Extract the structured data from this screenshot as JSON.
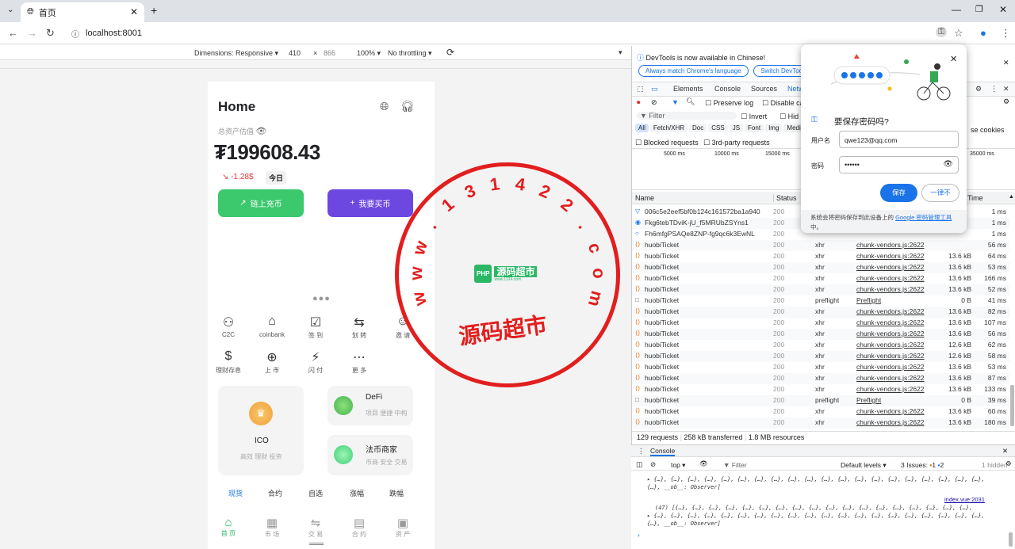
{
  "browser": {
    "tab_title": "首页",
    "url": "localhost:8001"
  },
  "device_toolbar": {
    "dimensions": "Dimensions: Responsive ▾",
    "width": "410",
    "height": "866",
    "zoom": "100% ▾",
    "throttle": "No throttling ▾"
  },
  "app": {
    "title": "Home",
    "balance_label": "总资产估值",
    "balance": "199608.43",
    "change": "-1.28$",
    "today": "今日",
    "btn_deposit": "链上充币",
    "btn_buy": "我要买币",
    "icons": [
      {
        "g": "⚇",
        "t": "C2C"
      },
      {
        "g": "⌂",
        "t": "coinbank"
      },
      {
        "g": "☑",
        "t": "签 到"
      },
      {
        "g": "⇆",
        "t": "划 转"
      },
      {
        "g": "☺",
        "t": "邀 请"
      },
      {
        "g": "$",
        "t": "理财存息"
      },
      {
        "g": "⊕",
        "t": "上 市"
      },
      {
        "g": "⚡",
        "t": "闪 付"
      },
      {
        "g": "⋯",
        "t": "更 多"
      }
    ],
    "ico_title": "ICO",
    "ico_sub": "高效 理财 投资",
    "defi_title": "DeFi",
    "defi_sub": "项目 便捷 中构",
    "fiat_title": "法币商家",
    "fiat_sub": "币商 安全 交易",
    "subtabs": [
      "现货",
      "合约",
      "自选",
      "涨幅",
      "跌幅"
    ],
    "bottom_nav": [
      {
        "g": "⌂",
        "t": "首 页"
      },
      {
        "g": "▦",
        "t": "市 场"
      },
      {
        "g": "⇋",
        "t": "交 易"
      },
      {
        "g": "▤",
        "t": "合 约"
      },
      {
        "g": "▣",
        "t": "资 产"
      }
    ]
  },
  "devtools": {
    "banner": "DevTools is now available in Chinese!",
    "btn_match": "Always match Chrome's language",
    "btn_switch": "Switch DevTool",
    "tabs": [
      "Elements",
      "Console",
      "Sources",
      "Netw"
    ],
    "preserve_log": "Preserve log",
    "disable_cache": "Disable ca",
    "filter": "Filter",
    "invert": "Invert",
    "hide": "Hid",
    "filters": [
      "All",
      "Fetch/XHR",
      "Doc",
      "CSS",
      "JS",
      "Font",
      "Img",
      "Medi"
    ],
    "third_party_cookies": "se cookies",
    "blocked": "Blocked requests",
    "third_party": "3rd-party requests",
    "timeline": [
      "5000 ms",
      "10000 ms",
      "15000 ms",
      "35000 ms"
    ],
    "cols": {
      "name": "Name",
      "status": "Status",
      "time": "Time"
    },
    "rows": [
      {
        "n": "006c5e2eef5bf0b124c161572ba1a940",
        "s": "200",
        "ty": "",
        "in": "",
        "sz": "",
        "tm": "1 ms",
        "ic": "▽"
      },
      {
        "n": "Fkg6tebTDviK-jU_f5MRUbZSYns1",
        "s": "200",
        "ty": "",
        "in": "",
        "sz": "",
        "tm": "1 ms",
        "ic": "◉"
      },
      {
        "n": "Fh6mfgPSAQe8ZNP-fg9qc6k3EwNL",
        "s": "200",
        "ty": "",
        "in": "",
        "sz": "",
        "tm": "1 ms",
        "ic": "○"
      },
      {
        "n": "huobiTicket",
        "s": "200",
        "ty": "xhr",
        "in": "chunk-vendors.js:2622",
        "sz": "",
        "tm": "56 ms",
        "ic": "⟨⟩"
      },
      {
        "n": "huobiTicket",
        "s": "200",
        "ty": "xhr",
        "in": "chunk-vendors.js:2622",
        "sz": "13.6 kB",
        "tm": "64 ms",
        "ic": "⟨⟩"
      },
      {
        "n": "huobiTicket",
        "s": "200",
        "ty": "xhr",
        "in": "chunk-vendors.js:2622",
        "sz": "13.6 kB",
        "tm": "53 ms",
        "ic": "⟨⟩"
      },
      {
        "n": "huobiTicket",
        "s": "200",
        "ty": "xhr",
        "in": "chunk-vendors.js:2622",
        "sz": "13.6 kB",
        "tm": "166 ms",
        "ic": "⟨⟩"
      },
      {
        "n": "huobiTicket",
        "s": "200",
        "ty": "xhr",
        "in": "chunk-vendors.js:2622",
        "sz": "13.6 kB",
        "tm": "52 ms",
        "ic": "⟨⟩"
      },
      {
        "n": "huobiTicket",
        "s": "200",
        "ty": "preflight",
        "in": "Preflight",
        "sz": "0 B",
        "tm": "41 ms",
        "ic": "□"
      },
      {
        "n": "huobiTicket",
        "s": "200",
        "ty": "xhr",
        "in": "chunk-vendors.js:2622",
        "sz": "13.6 kB",
        "tm": "82 ms",
        "ic": "⟨⟩"
      },
      {
        "n": "huobiTicket",
        "s": "200",
        "ty": "xhr",
        "in": "chunk-vendors.js:2622",
        "sz": "13.6 kB",
        "tm": "107 ms",
        "ic": "⟨⟩"
      },
      {
        "n": "huobiTicket",
        "s": "200",
        "ty": "xhr",
        "in": "chunk-vendors.js:2622",
        "sz": "13.6 kB",
        "tm": "56 ms",
        "ic": "⟨⟩"
      },
      {
        "n": "huobiTicket",
        "s": "200",
        "ty": "xhr",
        "in": "chunk-vendors.js:2622",
        "sz": "12.6 kB",
        "tm": "62 ms",
        "ic": "⟨⟩"
      },
      {
        "n": "huobiTicket",
        "s": "200",
        "ty": "xhr",
        "in": "chunk-vendors.js:2622",
        "sz": "12.6 kB",
        "tm": "58 ms",
        "ic": "⟨⟩"
      },
      {
        "n": "huobiTicket",
        "s": "200",
        "ty": "xhr",
        "in": "chunk-vendors.js:2622",
        "sz": "13.6 kB",
        "tm": "53 ms",
        "ic": "⟨⟩"
      },
      {
        "n": "huobiTicket",
        "s": "200",
        "ty": "xhr",
        "in": "chunk-vendors.js:2622",
        "sz": "13.6 kB",
        "tm": "87 ms",
        "ic": "⟨⟩"
      },
      {
        "n": "huobiTicket",
        "s": "200",
        "ty": "xhr",
        "in": "chunk-vendors.js:2622",
        "sz": "13.6 kB",
        "tm": "133 ms",
        "ic": "⟨⟩"
      },
      {
        "n": "huobiTicket",
        "s": "200",
        "ty": "preflight",
        "in": "Preflight",
        "sz": "0 B",
        "tm": "39 ms",
        "ic": "□"
      },
      {
        "n": "huobiTicket",
        "s": "200",
        "ty": "xhr",
        "in": "chunk-vendors.js:2622",
        "sz": "13.6 kB",
        "tm": "60 ms",
        "ic": "⟨⟩"
      },
      {
        "n": "huobiTicket",
        "s": "200",
        "ty": "xhr",
        "in": "chunk-vendors.js:2622",
        "sz": "13.6 kB",
        "tm": "180 ms",
        "ic": "⟨⟩"
      }
    ],
    "summary": {
      "requests": "129 requests",
      "transferred": "258 kB transferred",
      "resources": "1.8 MB resources"
    },
    "console_tab": "Console",
    "console_top": "top ▾",
    "console_filter": "Filter",
    "console_levels": "Default levels ▾",
    "console_issues": "3 Issues:",
    "console_issue_warn": "1",
    "console_issue_info": "2",
    "console_hidden": "1 hidden",
    "console_lines": [
      "▸ {…}, {…}, {…}, {…}, {…}, {…}, {…}, {…}, {…}, {…}, {…}, {…}, {…}, {…}, {…}, {…}, {…}, {…}, {…}, {…}, {…}, __ob__: Observer]",
      "index.vue:2031",
      "(47) [{…}, {…}, {…}, {…}, {…}, {…}, {…}, {…}, {…}, {…}, {…}, {…}, {…}, {…}, {…}, {…}, {…}, {…},",
      "▸ {…}, {…}, {…}, {…}, {…}, {…}, {…}, {…}, {…}, {…}, {…}, {…}, {…}, {…}, {…}, {…}, {…}, {…}, {…}, {…}, {…}, __ob__: Observer]"
    ]
  },
  "password_popup": {
    "title": "要保存密码吗?",
    "user_label": "用户名",
    "user_value": "qwe123@qq.com",
    "pw_label": "密码",
    "pw_value": "••••••",
    "save": "保存",
    "never": "一律不",
    "foot_text": "系统会将密码保存到此设备上的 ",
    "foot_link": "Google 密码管理工具",
    "foot_end": "中。"
  },
  "watermark": {
    "chars": [
      "w",
      "w",
      "w",
      ".",
      "1",
      "3",
      "1",
      "4",
      "2",
      "2",
      ".",
      "c",
      "o",
      "m"
    ],
    "bottom": "源码超市",
    "logo": "源码超市",
    "logo_small": "www.1314.com"
  }
}
